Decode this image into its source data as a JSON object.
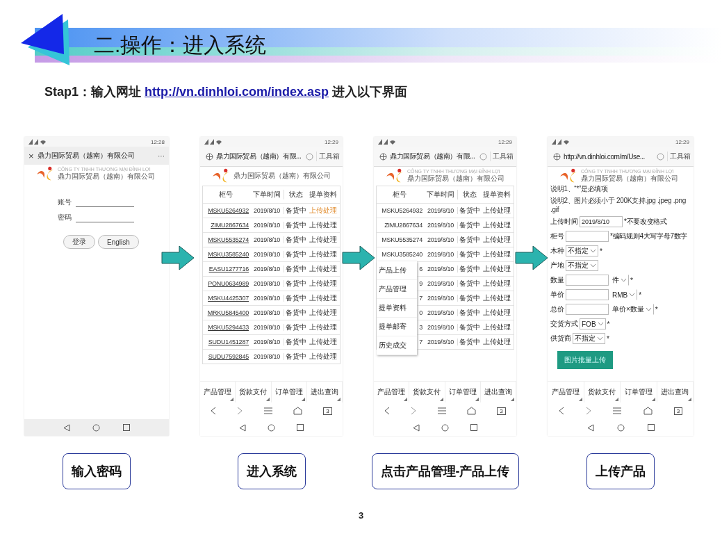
{
  "header": {
    "title": "二.操作：进入系统"
  },
  "step": {
    "prefix": "Stap1：输入网址",
    "link": "http://vn.dinhloi.com/index.asp",
    "suffix": "进入以下界面"
  },
  "phones": [
    {
      "kind": "login",
      "status_time": "12:28",
      "title_bar": {
        "close": "×",
        "title": "鼎力国际贸易（越南）有限公司",
        "more": "···"
      },
      "logo": {
        "line_vn": "CÔNG TY TNHH THƯƠNG MẠI ĐỈNH LỢI",
        "line_cn": "鼎力国际贸易（越南）有限公司"
      },
      "fields": [
        {
          "label": "账号"
        },
        {
          "label": "密码"
        }
      ],
      "buttons": [
        "登录",
        "English"
      ]
    },
    {
      "kind": "table",
      "status_time": "12:29",
      "address": "鼎力国际贸易（越南）有限...",
      "toolbox": "工具箱",
      "logo": {
        "line_cn": "鼎力国际贸易（越南）有限公司"
      },
      "table": {
        "linked": true,
        "columns": [
          "柜号",
          "下单时间",
          "状态",
          "提单资料"
        ],
        "rows": [
          {
            "cells": [
              "MSKU5264932",
              "2019/8/10",
              "备货中",
              "上传处理"
            ],
            "highlighted": true
          },
          {
            "cells": [
              "ZIMU2867634",
              "2019/8/10",
              "备货中",
              "上传处理"
            ],
            "highlighted": false
          },
          {
            "cells": [
              "MSKU5535274",
              "2019/8/10",
              "备货中",
              "上传处理"
            ],
            "highlighted": false
          },
          {
            "cells": [
              "MSKU3585240",
              "2019/8/10",
              "备货中",
              "上传处理"
            ],
            "highlighted": false
          },
          {
            "cells": [
              "EASU1277716",
              "2019/8/10",
              "备货中",
              "上传处理"
            ],
            "highlighted": false
          },
          {
            "cells": [
              "PONU0634989",
              "2019/8/10",
              "备货中",
              "上传处理"
            ],
            "highlighted": false
          },
          {
            "cells": [
              "MSKU4425307",
              "2019/8/10",
              "备货中",
              "上传处理"
            ],
            "highlighted": false
          },
          {
            "cells": [
              "MRKU5845400",
              "2019/8/10",
              "备货中",
              "上传处理"
            ],
            "highlighted": false
          },
          {
            "cells": [
              "MSKU5294433",
              "2019/8/10",
              "备货中",
              "上传处理"
            ],
            "highlighted": false
          },
          {
            "cells": [
              "SUDU1451287",
              "2019/8/10",
              "备货中",
              "上传处理"
            ],
            "highlighted": false
          },
          {
            "cells": [
              "SUDU7592845",
              "2019/8/10",
              "备货中",
              "上传处理"
            ],
            "highlighted": false
          }
        ]
      },
      "menu_tabs": [
        "产品管理",
        "货款支付",
        "订单管理",
        "进出查询"
      ],
      "tab_count": "3"
    },
    {
      "kind": "table",
      "status_time": "12:29",
      "address": "鼎力国际贸易（越南）有限...",
      "toolbox": "工具箱",
      "logo": {
        "line_vn": "CÔNG TY TNHH THƯƠNG MẠI ĐỈNH LỢI",
        "line_cn": "鼎力国际贸易（越南）有限公司"
      },
      "table": {
        "linked": false,
        "columns": [
          "柜号",
          "下单时间",
          "状态",
          "提单资料"
        ],
        "rows": [
          {
            "cells": [
              "MSKU5264932",
              "2019/8/10",
              "备货中",
              "上传处理"
            ],
            "highlighted": false
          },
          {
            "cells": [
              "ZIMU2867634",
              "2019/8/10",
              "备货中",
              "上传处理"
            ],
            "highlighted": false
          },
          {
            "cells": [
              "MSKU5535274",
              "2019/8/10",
              "备货中",
              "上传处理"
            ],
            "highlighted": false
          },
          {
            "cells": [
              "MSKU3585240",
              "2019/8/10",
              "备货中",
              "上传处理"
            ],
            "highlighted": false
          },
          {
            "cells": [
              "6",
              "2019/8/10",
              "备货中",
              "上传处理"
            ],
            "highlighted": false
          },
          {
            "cells": [
              "9",
              "2019/8/10",
              "备货中",
              "上传处理"
            ],
            "highlighted": false
          },
          {
            "cells": [
              "7",
              "2019/8/10",
              "备货中",
              "上传处理"
            ],
            "highlighted": false
          },
          {
            "cells": [
              "0",
              "2019/8/10",
              "备货中",
              "上传处理"
            ],
            "highlighted": false
          },
          {
            "cells": [
              "3",
              "2019/8/10",
              "备货中",
              "上传处理"
            ],
            "highlighted": false
          },
          {
            "cells": [
              "7",
              "2019/8/10",
              "备货中",
              "上传处理"
            ],
            "highlighted": false
          }
        ]
      },
      "popup_menu": [
        "产品上传",
        "产品管理",
        "提单资料",
        "提单邮寄",
        "历史成交"
      ],
      "menu_tabs": [
        "产品管理",
        "货款支付",
        "订单管理",
        "进出查询"
      ],
      "tab_count": "3"
    },
    {
      "kind": "form",
      "status_time": "12:29",
      "address": "http://vn.dinhloi.com/m/Use...",
      "toolbox": "工具箱",
      "logo": {
        "line_vn": "CÔNG TY TNHH THƯƠNG MẠI ĐỈNH LỢI",
        "line_cn": "鼎力国际贸易（越南）有限公司"
      },
      "notes": [
        "说明1、“*”是必填项",
        "说明2、图片必须小于 200K支持.jpg .jpeg .png .gif"
      ],
      "form_rows": [
        {
          "kind": "input",
          "label": "上传时间",
          "value": "2019/8/10",
          "note": "*不要改变格式"
        },
        {
          "kind": "input",
          "label": "柜号",
          "note": "*编码规则4大写字母7数字"
        },
        {
          "kind": "select",
          "label": "木种",
          "value": "不指定",
          "note": "*"
        },
        {
          "kind": "select",
          "label": "产地",
          "value": "不指定"
        },
        {
          "kind": "input_select",
          "label": "数量",
          "value": "件",
          "note": "*"
        },
        {
          "kind": "input_select",
          "label": "单价",
          "value": "RMB",
          "note": "*"
        },
        {
          "kind": "input_select",
          "label": "总价",
          "value": "单价×数量",
          "note": "*"
        },
        {
          "kind": "select",
          "label": "交货方式",
          "value": "FOB",
          "note": "*"
        },
        {
          "kind": "select",
          "label": "供货商",
          "value": "不指定",
          "note": "*"
        }
      ],
      "upload_button": "图片批量上传",
      "menu_tabs": [
        "产品管理",
        "货款支付",
        "订单管理",
        "进出查询"
      ],
      "tab_count": "3"
    }
  ],
  "captions": [
    "输入密码",
    "进入系统",
    "点击产品管理-产品上传",
    "上传产品"
  ],
  "page_number": "3"
}
